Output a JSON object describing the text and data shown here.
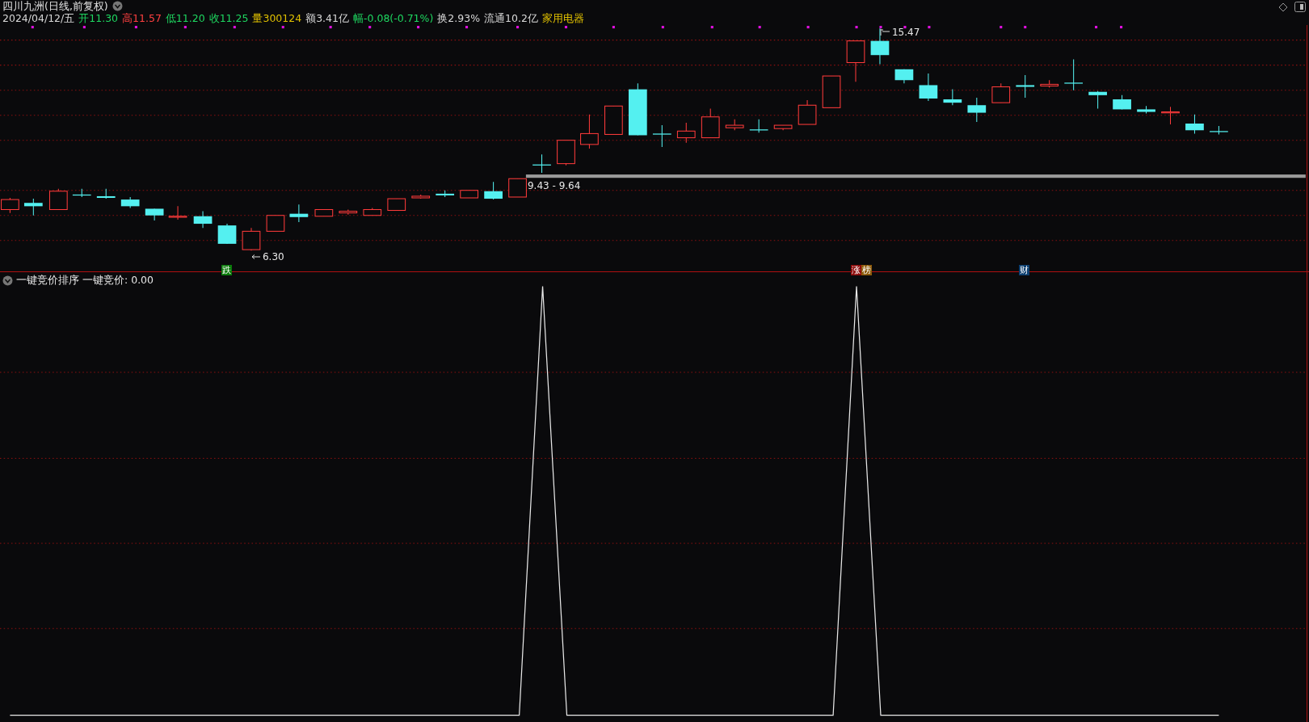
{
  "header": {
    "title": "四川九洲(日线,前复权)",
    "quote": [
      {
        "text": "2024/04/12/五",
        "color": "#d8d8d8"
      },
      {
        "text": "开11.30",
        "color": "#1ed760"
      },
      {
        "text": "高11.57",
        "color": "#ff4040"
      },
      {
        "text": "低11.20",
        "color": "#1ed760"
      },
      {
        "text": "收11.25",
        "color": "#1ed760"
      },
      {
        "text": "量300124",
        "color": "#e0c000"
      },
      {
        "text": "额3.41亿",
        "color": "#d8d8d8"
      },
      {
        "text": "幅-0.08(-0.71%)",
        "color": "#1ed760"
      },
      {
        "text": "换2.93%",
        "color": "#d8d8d8"
      },
      {
        "text": "流通10.2亿",
        "color": "#d8d8d8"
      },
      {
        "text": "家用电器",
        "color": "#e0c000"
      }
    ]
  },
  "price_chart": {
    "high_label": "15.47",
    "low_label": "6.30",
    "band_label": "9.43 - 9.64",
    "tags": [
      {
        "text": "跌",
        "color": "#0a7a0a"
      },
      {
        "text": "涨",
        "color": "#8c0a0a"
      },
      {
        "text": "榜",
        "color": "#8c5a0a"
      },
      {
        "text": "财",
        "color": "#0d3f70"
      }
    ]
  },
  "indicator": {
    "name": "一键竞价排序",
    "reading": "一键竞价: 0.00"
  }
}
